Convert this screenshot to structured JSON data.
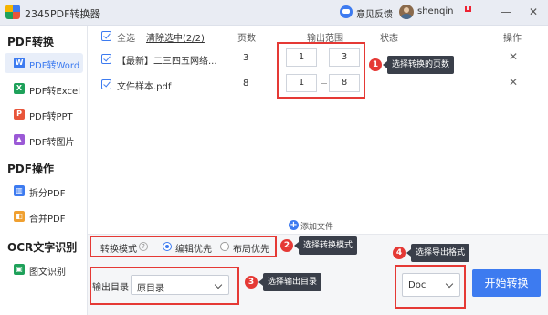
{
  "titlebar": {
    "title": "2345PDF转换器",
    "feedback": "意见反馈",
    "username": "shenqin",
    "minimize": "—",
    "close": "✕"
  },
  "sidebar": {
    "sections": [
      {
        "title": "PDF转换",
        "items": [
          {
            "label": "PDF转Word",
            "icon": "word-icon",
            "icon_text": "W",
            "color": "#3d7bf0",
            "active": true
          },
          {
            "label": "PDF转Excel",
            "icon": "excel-icon",
            "icon_text": "X",
            "color": "#1ea15a",
            "active": false
          },
          {
            "label": "PDF转PPT",
            "icon": "ppt-icon",
            "icon_text": "P",
            "color": "#e8553a",
            "active": false
          },
          {
            "label": "PDF转图片",
            "icon": "image-icon",
            "icon_text": "▲",
            "color": "#9b59d6",
            "active": false
          }
        ]
      },
      {
        "title": "PDF操作",
        "items": [
          {
            "label": "拆分PDF",
            "icon": "split-icon",
            "icon_text": "▥",
            "color": "#3d7bf0",
            "active": false
          },
          {
            "label": "合并PDF",
            "icon": "merge-icon",
            "icon_text": "◧",
            "color": "#f0a030",
            "active": false
          }
        ]
      },
      {
        "title": "OCR文字识别",
        "items": [
          {
            "label": "图文识别",
            "icon": "ocr-icon",
            "icon_text": "▣",
            "color": "#1ea15a",
            "active": false
          }
        ]
      }
    ]
  },
  "table": {
    "select_all": "全选",
    "clear_selected": "清除选中(2/2)",
    "col_pages": "页数",
    "col_range": "输出范围",
    "col_status": "状态",
    "col_action": "操作",
    "rows": [
      {
        "name": "【最新】二三四五网络...",
        "pages": "3",
        "from": "1",
        "to": "3",
        "checked": true
      },
      {
        "name": "文件样本.pdf",
        "pages": "8",
        "from": "1",
        "to": "8",
        "checked": true
      }
    ]
  },
  "add_file": "添加文件",
  "mode": {
    "label": "转换模式",
    "options": [
      {
        "label": "编辑优先",
        "selected": true
      },
      {
        "label": "布局优先",
        "selected": false
      }
    ]
  },
  "output": {
    "dir_label": "输出目录",
    "dir_value": "原目录",
    "format_value": "Doc",
    "start_button": "开始转换"
  },
  "annotations": [
    {
      "number": "1",
      "text": "选择转换的页数"
    },
    {
      "number": "2",
      "text": "选择转换模式"
    },
    {
      "number": "3",
      "text": "选择输出目录"
    },
    {
      "number": "4",
      "text": "选择导出格式"
    }
  ],
  "colors": {
    "accent": "#3d7bf0",
    "annotation": "#e53935",
    "callout_bg": "#3a3f4a"
  }
}
